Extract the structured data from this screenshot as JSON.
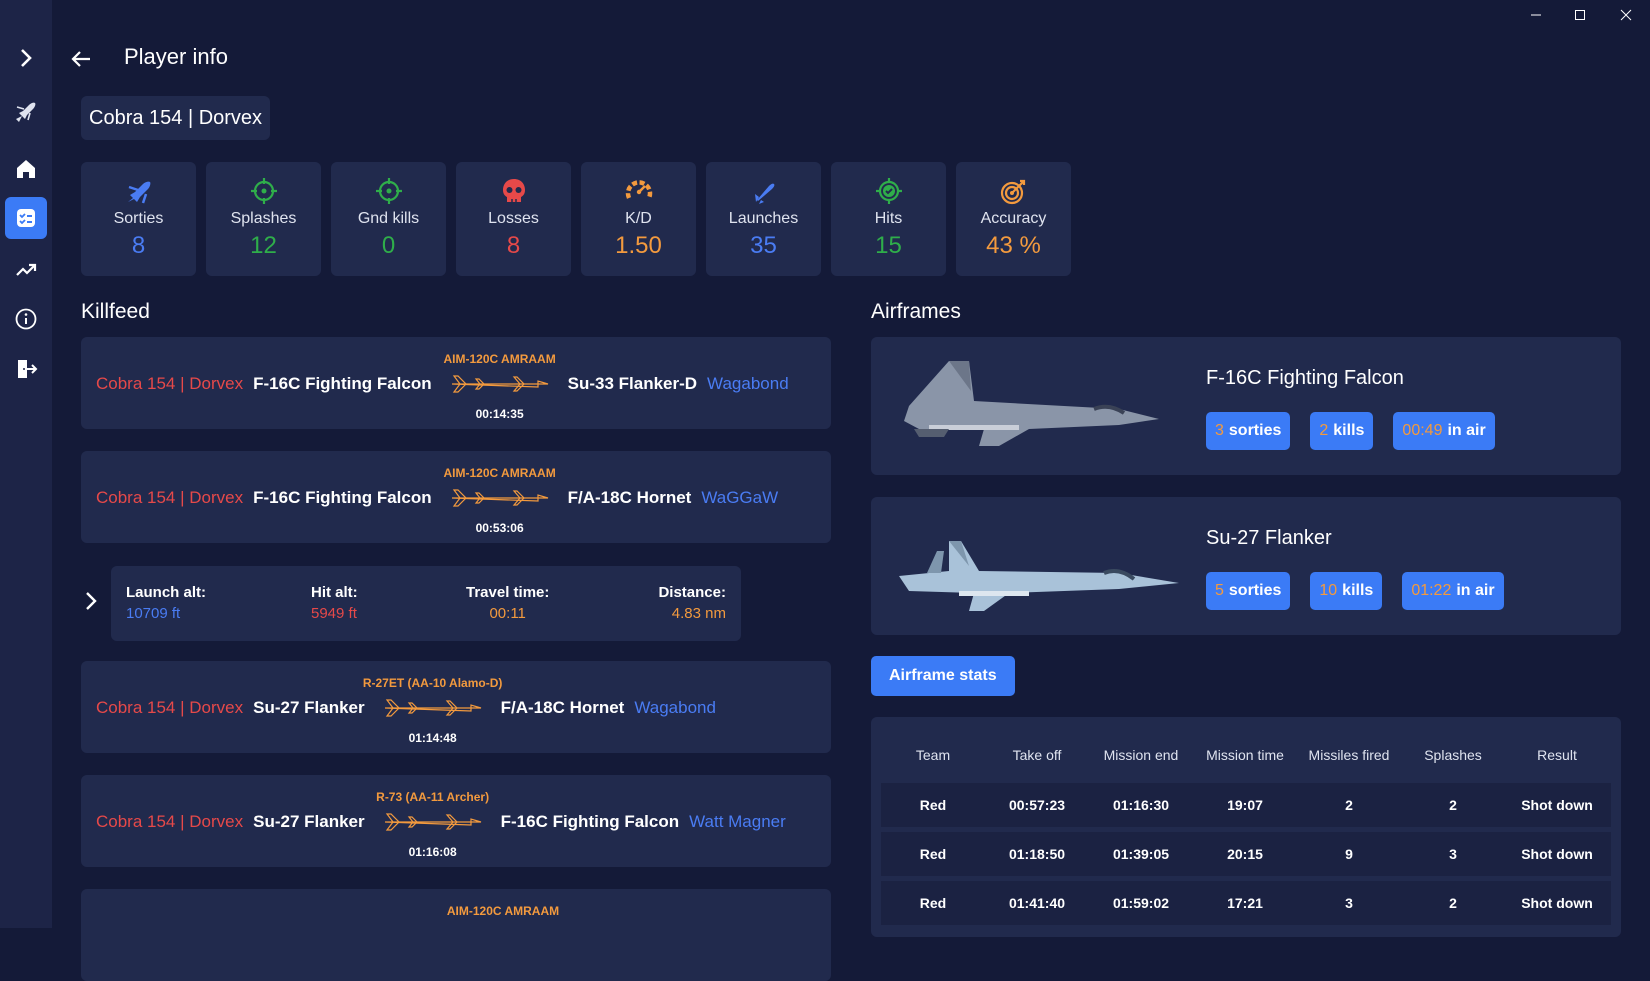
{
  "window": {
    "minimize": "—",
    "maximize": "☐",
    "close": "✕"
  },
  "header": {
    "title": "Player info"
  },
  "player": {
    "name": "Cobra 154 | Dorvex"
  },
  "stats": [
    {
      "label": "Sorties",
      "value": "8",
      "color": "#4a7cf3",
      "icon": "jet-icon"
    },
    {
      "label": "Splashes",
      "value": "12",
      "color": "#2fae4a",
      "icon": "crosshair-icon"
    },
    {
      "label": "Gnd kills",
      "value": "0",
      "color": "#2fae4a",
      "icon": "crosshair-icon"
    },
    {
      "label": "Losses",
      "value": "8",
      "color": "#e64949",
      "icon": "skull-icon"
    },
    {
      "label": "K/D",
      "value": "1.50",
      "color": "#f39a3e",
      "icon": "gauge-icon"
    },
    {
      "label": "Launches",
      "value": "35",
      "color": "#4a7cf3",
      "icon": "missile-icon"
    },
    {
      "label": "Hits",
      "value": "15",
      "color": "#2fae4a",
      "icon": "target-check-icon"
    },
    {
      "label": "Accuracy",
      "value": "43 %",
      "color": "#f39a3e",
      "icon": "bullseye-icon"
    }
  ],
  "killfeed": {
    "title": "Killfeed",
    "items": [
      {
        "weapon": "AIM-120C AMRAAM",
        "killer": "Cobra 154 | Dorvex",
        "killer_ac": "F-16C Fighting Falcon",
        "victim_ac": "Su-33 Flanker-D",
        "victim": "Wagabond",
        "time": "00:14:35"
      },
      {
        "weapon": "AIM-120C AMRAAM",
        "killer": "Cobra 154 | Dorvex",
        "killer_ac": "F-16C Fighting Falcon",
        "victim_ac": "F/A-18C Hornet",
        "victim": "WaGGaW",
        "time": "00:53:06"
      },
      {
        "weapon": "R-27ET (AA-10 Alamo-D)",
        "killer": "Cobra 154 | Dorvex",
        "killer_ac": "Su-27 Flanker",
        "victim_ac": "F/A-18C Hornet",
        "victim": "Wagabond",
        "time": "01:14:48"
      },
      {
        "weapon": "R-73 (AA-11 Archer)",
        "killer": "Cobra 154 | Dorvex",
        "killer_ac": "Su-27 Flanker",
        "victim_ac": "F-16C Fighting Falcon",
        "victim": "Watt Magner",
        "time": "01:16:08"
      },
      {
        "weapon": "AIM-120C AMRAAM"
      }
    ],
    "detail": {
      "launch_alt_label": "Launch alt:",
      "launch_alt": "10709 ft",
      "hit_alt_label": "Hit alt:",
      "hit_alt": "5949 ft",
      "travel_label": "Travel time:",
      "travel": "00:11",
      "distance_label": "Distance:",
      "distance": "4.83 nm"
    }
  },
  "airframes": {
    "title": "Airframes",
    "items": [
      {
        "name": "F-16C Fighting Falcon",
        "sorties": "3",
        "sorties_label": "sorties",
        "kills": "2",
        "kills_label": "kills",
        "air": "00:49",
        "air_label": "in air"
      },
      {
        "name": "Su-27 Flanker",
        "sorties": "5",
        "sorties_label": "sorties",
        "kills": "10",
        "kills_label": "kills",
        "air": "01:22",
        "air_label": "in air"
      }
    ],
    "stats_button": "Airframe stats"
  },
  "table": {
    "headers": [
      "Team",
      "Take off",
      "Mission end",
      "Mission time",
      "Missiles fired",
      "Splashes",
      "Result"
    ],
    "rows": [
      [
        "Red",
        "00:57:23",
        "01:16:30",
        "19:07",
        "2",
        "2",
        "Shot down"
      ],
      [
        "Red",
        "01:18:50",
        "01:39:05",
        "20:15",
        "9",
        "3",
        "Shot down"
      ],
      [
        "Red",
        "01:41:40",
        "01:59:02",
        "17:21",
        "3",
        "2",
        "Shot down"
      ]
    ]
  }
}
